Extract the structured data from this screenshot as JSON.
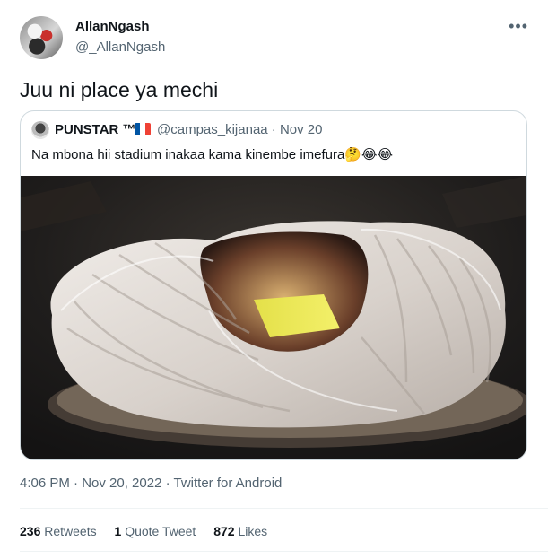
{
  "tweet": {
    "name": "AllanNgash",
    "handle": "@_AllanNgash",
    "more": "•••",
    "text": "Juu ni place ya mechi",
    "timestamp": "4:06 PM · Nov 20, 2022 · Twitter for Android"
  },
  "quote": {
    "name": "PUNSTAR ™",
    "handle": "@campas_kijanaa · Nov 20",
    "text": "Na mbona hii stadium inakaa kama kinembe imefura",
    "emojis": "🤔😂😂",
    "flag_colors": [
      "#0055a4",
      "#ffffff",
      "#ef4135"
    ]
  },
  "stats": {
    "retweets_count": "236",
    "retweets_label": "Retweets",
    "quotes_count": "1",
    "quotes_label": "Quote Tweet",
    "likes_count": "872",
    "likes_label": "Likes"
  },
  "colors": {
    "text": "#0f1419",
    "secondary": "#536471",
    "border": "#cfd9de"
  }
}
